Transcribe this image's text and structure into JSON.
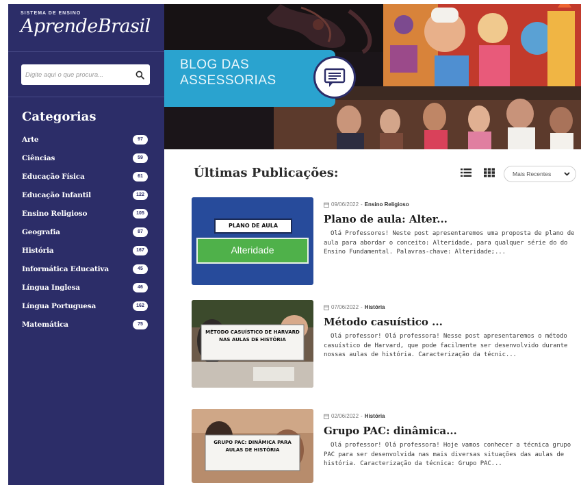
{
  "sidebar": {
    "brand_top": "SISTEMA DE ENSINO",
    "brand_name": "AprendeBrasil",
    "search_placeholder": "Digite aqui o que procura...",
    "categories_title": "Categorias",
    "categories": [
      {
        "label": "Arte",
        "count": "97"
      },
      {
        "label": "Ciências",
        "count": "59"
      },
      {
        "label": "Educação Física",
        "count": "61"
      },
      {
        "label": "Educação Infantil",
        "count": "122"
      },
      {
        "label": "Ensino Religioso",
        "count": "105"
      },
      {
        "label": "Geografia",
        "count": "87"
      },
      {
        "label": "História",
        "count": "167"
      },
      {
        "label": "Informática Educativa",
        "count": "45"
      },
      {
        "label": "Língua Inglesa",
        "count": "46"
      },
      {
        "label": "Língua Portuguesa",
        "count": "162"
      },
      {
        "label": "Matemática",
        "count": "75"
      }
    ]
  },
  "banner": {
    "title_line1": "BLOG DAS",
    "title_line2": "ASSESSORIAS"
  },
  "main": {
    "heading": "Últimas Publicações:",
    "sort_label": "Mais Recentes",
    "posts": [
      {
        "date": "09/06/2022",
        "category": "Ensino Religioso",
        "title": "Plano de aula: Alter...",
        "excerpt": "Olá Professores!  Neste post apresentaremos uma proposta de plano de aula para abordar o conceito: Alteridade, para qualquer série do do Ensino Fundamental.   Palavras-chave: Alteridade;...",
        "thumb_label": "PLANO DE AULA",
        "thumb_word": "Alteridade"
      },
      {
        "date": "07/06/2022",
        "category": "História",
        "title": "Método casuístico ...",
        "excerpt": "Olá professor! Olá professora!  Nesse post apresentaremos o método casuístico de Harvard, que pode facilmente ser desenvolvido durante nossas aulas de história.   Caracterização da técnic...",
        "thumb_label": "MÉTODO CASUÍSTICO DE HARVARD NAS AULAS DE HISTÓRIA"
      },
      {
        "date": "02/06/2022",
        "category": "História",
        "title": "Grupo PAC: dinâmica...",
        "excerpt": "Olá professor! Olá professora!  Hoje vamos conhecer a técnica grupo PAC para ser desenvolvida nas mais diversas situações das aulas de história.   Caracterização da técnica: Grupo PAC...",
        "thumb_label": "GRUPO PAC: DINÂMICA PARA AULAS DE HISTÓRIA"
      }
    ]
  },
  "colors": {
    "sidebar_bg": "#2c2d68",
    "accent_blue": "#2aa3cf",
    "thumb_green": "#4fb14a",
    "thumb_blue": "#2b4fa6"
  },
  "icons": [
    "search-icon",
    "chat-icon",
    "list-view-icon",
    "grid-view-icon",
    "chevron-down-icon",
    "calendar-icon"
  ]
}
